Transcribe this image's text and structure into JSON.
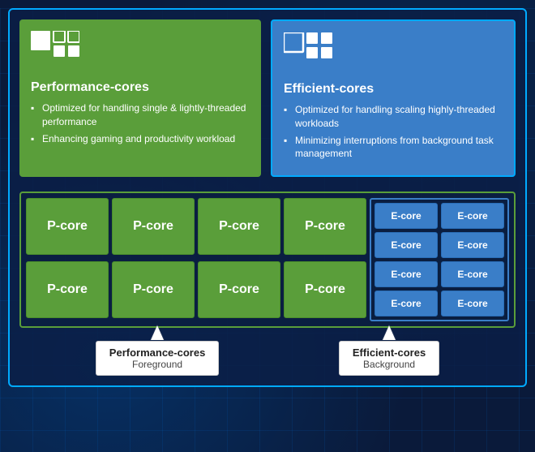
{
  "p_cores_desc": {
    "title": "Performance-cores",
    "bullets": [
      "Optimized for handling single & lightly-threaded performance",
      "Enhancing gaming and productivity workload"
    ]
  },
  "e_cores_desc": {
    "title": "Efficient-cores",
    "bullets": [
      "Optimized for handling scaling highly-threaded workloads",
      "Minimizing interruptions from background task management"
    ]
  },
  "p_core_cells": [
    "P-core",
    "P-core",
    "P-core",
    "P-core",
    "P-core",
    "P-core",
    "P-core",
    "P-core"
  ],
  "e_core_cells": [
    "E-core",
    "E-core",
    "E-core",
    "E-core",
    "E-core",
    "E-core",
    "E-core",
    "E-core"
  ],
  "label_p": {
    "title": "Performance-cores",
    "subtitle": "Foreground"
  },
  "label_e": {
    "title": "Efficient-cores",
    "subtitle": "Background"
  }
}
